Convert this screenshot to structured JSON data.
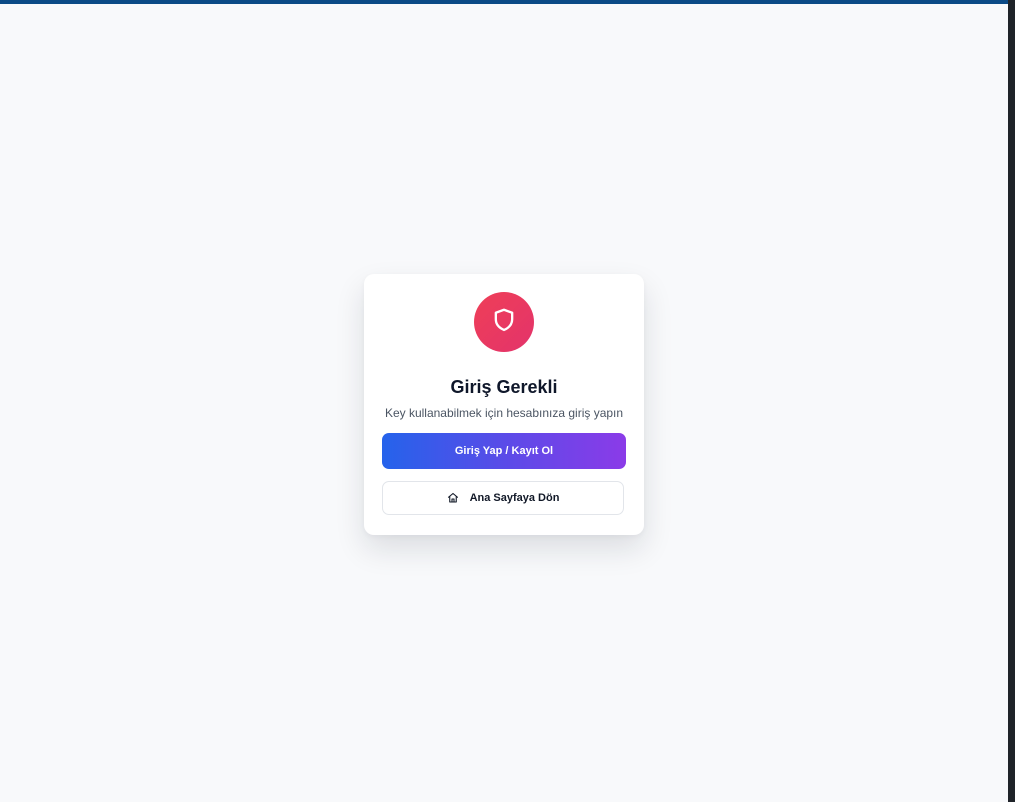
{
  "auth_card": {
    "title": "Giriş Gerekli",
    "subtitle": "Key kullanabilmek için hesabınıza giriş yapın",
    "login_button_label": "Giriş Yap / Kayıt Ol",
    "home_button_label": "Ana Sayfaya Dön",
    "icons": {
      "badge": "shield-icon",
      "home": "home-icon"
    }
  },
  "colors": {
    "page_background": "#f8f9fb",
    "top_bar": "#0b4a86",
    "shield_badge": "#e8395f",
    "login_gradient_start": "#2563eb",
    "login_gradient_end": "#8b3be8",
    "title_text": "#0f172a"
  }
}
